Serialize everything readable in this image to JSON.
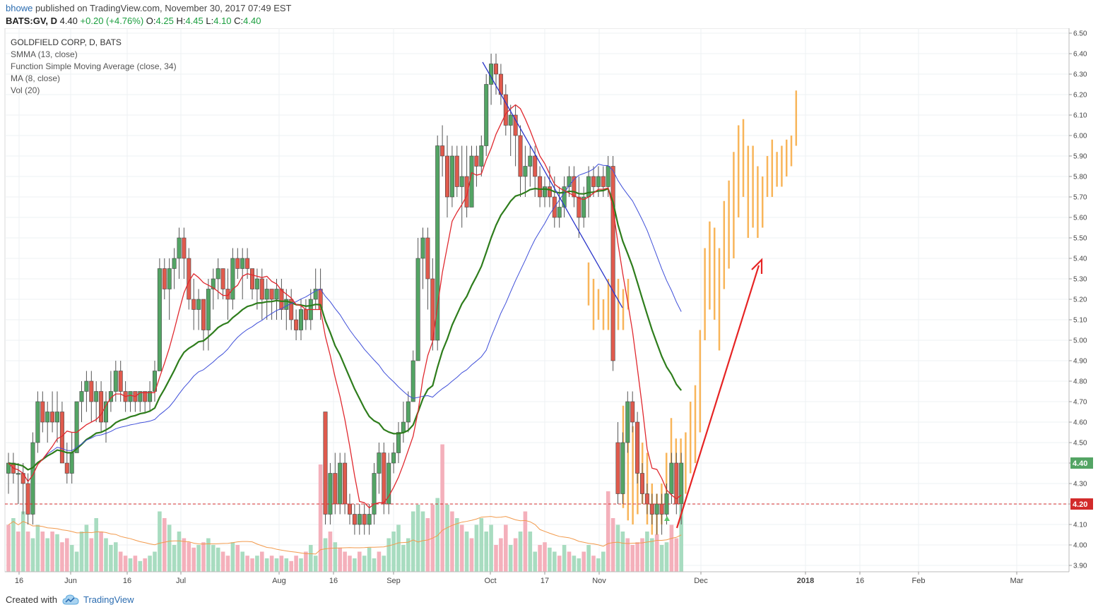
{
  "header": {
    "author": "bhowe",
    "published_text": "published on TradingView.com, November 30, 2017 07:49 EST",
    "symbol": "BATS:GV, D",
    "last": "4.40",
    "change": "+0.20 (+4.76%)",
    "o_label": "O:",
    "o_value": "4.25",
    "h_label": "H:",
    "h_value": "4.45",
    "l_label": "L:",
    "l_value": "4.10",
    "c_label": "C:",
    "c_value": "4.40"
  },
  "legend": {
    "title": "GOLDFIELD CORP, D, BATS",
    "lines": [
      "SMMA (13, close)",
      "Function Simple Moving Average (close, 34)",
      "MA (8, close)",
      "Vol (20)"
    ]
  },
  "footer": {
    "created_with": "Created with",
    "brand": "TradingView"
  },
  "colors": {
    "up": "#53a464",
    "down": "#e05a4d",
    "smma": "#2e7d1c",
    "sma34": "#3f4fd9",
    "ma8": "#e0292f",
    "vol_ma": "#f29a4c",
    "vol_up": "#a8dcc0",
    "vol_down": "#f4b0bb",
    "projection": "#f8b55a",
    "trend_blue": "#2a35c9",
    "arrow": "#e62424",
    "hline": "#d22b2b"
  },
  "chart_data": {
    "type": "candlestick",
    "symbol": "BATS:GV",
    "ylim": [
      3.85,
      6.5
    ],
    "y_ticks": [
      "6.50",
      "6.40",
      "6.30",
      "6.20",
      "6.10",
      "6.00",
      "5.90",
      "5.80",
      "5.70",
      "5.60",
      "5.50",
      "5.40",
      "5.30",
      "5.20",
      "5.10",
      "5.00",
      "4.90",
      "4.80",
      "4.70",
      "4.60",
      "4.50",
      "4.40",
      "4.30",
      "4.20",
      "4.10",
      "4.00",
      "3.90"
    ],
    "x_ticks": [
      "16",
      "Jun",
      "16",
      "Jul",
      "Aug",
      "16",
      "Sep",
      "Oct",
      "17",
      "Nov",
      "Dec",
      "2018",
      "16",
      "Feb",
      "Mar"
    ],
    "last_price_label": "4.40",
    "horizontal_line": {
      "value": 4.2,
      "label": "4.20"
    },
    "candles": [
      {
        "o": 4.35,
        "h": 4.45,
        "l": 4.25,
        "c": 4.4
      },
      {
        "o": 4.4,
        "h": 4.45,
        "l": 4.3,
        "c": 4.35
      },
      {
        "o": 4.35,
        "h": 4.4,
        "l": 4.2,
        "c": 4.35
      },
      {
        "o": 4.35,
        "h": 4.4,
        "l": 4.15,
        "c": 4.3
      },
      {
        "o": 4.3,
        "h": 4.35,
        "l": 4.1,
        "c": 4.15
      },
      {
        "o": 4.15,
        "h": 4.55,
        "l": 4.1,
        "c": 4.5
      },
      {
        "o": 4.5,
        "h": 4.75,
        "l": 4.45,
        "c": 4.7
      },
      {
        "o": 4.7,
        "h": 4.75,
        "l": 4.55,
        "c": 4.6
      },
      {
        "o": 4.6,
        "h": 4.7,
        "l": 4.5,
        "c": 4.65
      },
      {
        "o": 4.65,
        "h": 4.75,
        "l": 4.55,
        "c": 4.6
      },
      {
        "o": 4.6,
        "h": 4.75,
        "l": 4.5,
        "c": 4.65
      },
      {
        "o": 4.65,
        "h": 4.7,
        "l": 4.4,
        "c": 4.4
      },
      {
        "o": 4.4,
        "h": 4.5,
        "l": 4.3,
        "c": 4.35
      },
      {
        "o": 4.35,
        "h": 4.55,
        "l": 4.3,
        "c": 4.45
      },
      {
        "o": 4.45,
        "h": 4.7,
        "l": 4.45,
        "c": 4.7
      },
      {
        "o": 4.7,
        "h": 4.8,
        "l": 4.6,
        "c": 4.75
      },
      {
        "o": 4.75,
        "h": 4.85,
        "l": 4.65,
        "c": 4.8
      },
      {
        "o": 4.8,
        "h": 4.85,
        "l": 4.6,
        "c": 4.7
      },
      {
        "o": 4.7,
        "h": 4.8,
        "l": 4.6,
        "c": 4.75
      },
      {
        "o": 4.75,
        "h": 4.8,
        "l": 4.55,
        "c": 4.6
      },
      {
        "o": 4.6,
        "h": 4.75,
        "l": 4.5,
        "c": 4.7
      },
      {
        "o": 4.7,
        "h": 4.85,
        "l": 4.65,
        "c": 4.75
      },
      {
        "o": 4.75,
        "h": 4.9,
        "l": 4.7,
        "c": 4.85
      },
      {
        "o": 4.85,
        "h": 4.9,
        "l": 4.7,
        "c": 4.75
      },
      {
        "o": 4.75,
        "h": 4.8,
        "l": 4.65,
        "c": 4.7
      },
      {
        "o": 4.7,
        "h": 4.75,
        "l": 4.65,
        "c": 4.75
      },
      {
        "o": 4.75,
        "h": 4.75,
        "l": 4.65,
        "c": 4.7
      },
      {
        "o": 4.7,
        "h": 4.75,
        "l": 4.65,
        "c": 4.75
      },
      {
        "o": 4.75,
        "h": 4.75,
        "l": 4.65,
        "c": 4.7
      },
      {
        "o": 4.7,
        "h": 4.8,
        "l": 4.65,
        "c": 4.75
      },
      {
        "o": 4.75,
        "h": 4.9,
        "l": 4.7,
        "c": 4.85
      },
      {
        "o": 4.85,
        "h": 5.4,
        "l": 4.85,
        "c": 5.35
      },
      {
        "o": 5.35,
        "h": 5.4,
        "l": 5.2,
        "c": 5.25
      },
      {
        "o": 5.25,
        "h": 5.4,
        "l": 5.1,
        "c": 5.35
      },
      {
        "o": 5.35,
        "h": 5.45,
        "l": 5.25,
        "c": 5.4
      },
      {
        "o": 5.4,
        "h": 5.55,
        "l": 5.3,
        "c": 5.5
      },
      {
        "o": 5.5,
        "h": 5.55,
        "l": 5.3,
        "c": 5.4
      },
      {
        "o": 5.4,
        "h": 5.45,
        "l": 5.15,
        "c": 5.2
      },
      {
        "o": 5.2,
        "h": 5.3,
        "l": 5.05,
        "c": 5.15
      },
      {
        "o": 5.15,
        "h": 5.25,
        "l": 5.05,
        "c": 5.2
      },
      {
        "o": 5.2,
        "h": 5.2,
        "l": 4.95,
        "c": 5.05
      },
      {
        "o": 5.05,
        "h": 5.3,
        "l": 4.95,
        "c": 5.25
      },
      {
        "o": 5.25,
        "h": 5.35,
        "l": 5.15,
        "c": 5.3
      },
      {
        "o": 5.3,
        "h": 5.4,
        "l": 5.2,
        "c": 5.35
      },
      {
        "o": 5.35,
        "h": 5.35,
        "l": 5.2,
        "c": 5.25
      },
      {
        "o": 5.25,
        "h": 5.35,
        "l": 5.1,
        "c": 5.2
      },
      {
        "o": 5.2,
        "h": 5.45,
        "l": 5.15,
        "c": 5.4
      },
      {
        "o": 5.4,
        "h": 5.45,
        "l": 5.3,
        "c": 5.35
      },
      {
        "o": 5.35,
        "h": 5.45,
        "l": 5.2,
        "c": 5.4
      },
      {
        "o": 5.4,
        "h": 5.45,
        "l": 5.3,
        "c": 5.35
      },
      {
        "o": 5.35,
        "h": 5.35,
        "l": 5.2,
        "c": 5.25
      },
      {
        "o": 5.25,
        "h": 5.35,
        "l": 5.15,
        "c": 5.3
      },
      {
        "o": 5.3,
        "h": 5.35,
        "l": 5.1,
        "c": 5.2
      },
      {
        "o": 5.2,
        "h": 5.3,
        "l": 5.1,
        "c": 5.25
      },
      {
        "o": 5.25,
        "h": 5.25,
        "l": 5.1,
        "c": 5.2
      },
      {
        "o": 5.2,
        "h": 5.3,
        "l": 5.1,
        "c": 5.25
      },
      {
        "o": 5.25,
        "h": 5.3,
        "l": 5.1,
        "c": 5.15
      },
      {
        "o": 5.15,
        "h": 5.25,
        "l": 5.05,
        "c": 5.2
      },
      {
        "o": 5.2,
        "h": 5.25,
        "l": 5.05,
        "c": 5.1
      },
      {
        "o": 5.1,
        "h": 5.15,
        "l": 5.0,
        "c": 5.05
      },
      {
        "o": 5.05,
        "h": 5.2,
        "l": 5.0,
        "c": 5.15
      },
      {
        "o": 5.15,
        "h": 5.2,
        "l": 5.05,
        "c": 5.1
      },
      {
        "o": 5.1,
        "h": 5.25,
        "l": 5.05,
        "c": 5.2
      },
      {
        "o": 5.2,
        "h": 5.35,
        "l": 5.15,
        "c": 5.25
      },
      {
        "o": 5.25,
        "h": 5.35,
        "l": 5.1,
        "c": 5.15
      },
      {
        "o": 4.65,
        "h": 4.65,
        "l": 4.1,
        "c": 4.15
      },
      {
        "o": 4.15,
        "h": 4.4,
        "l": 4.1,
        "c": 4.35
      },
      {
        "o": 4.35,
        "h": 4.45,
        "l": 4.15,
        "c": 4.2
      },
      {
        "o": 4.2,
        "h": 4.45,
        "l": 4.15,
        "c": 4.4
      },
      {
        "o": 4.4,
        "h": 4.45,
        "l": 4.15,
        "c": 4.2
      },
      {
        "o": 4.2,
        "h": 4.25,
        "l": 4.1,
        "c": 4.15
      },
      {
        "o": 4.15,
        "h": 4.2,
        "l": 4.05,
        "c": 4.1
      },
      {
        "o": 4.1,
        "h": 4.2,
        "l": 4.05,
        "c": 4.15
      },
      {
        "o": 4.15,
        "h": 4.2,
        "l": 4.05,
        "c": 4.1
      },
      {
        "o": 4.1,
        "h": 4.2,
        "l": 4.05,
        "c": 4.15
      },
      {
        "o": 4.15,
        "h": 4.4,
        "l": 4.1,
        "c": 4.35
      },
      {
        "o": 4.35,
        "h": 4.5,
        "l": 4.25,
        "c": 4.45
      },
      {
        "o": 4.45,
        "h": 4.5,
        "l": 4.15,
        "c": 4.2
      },
      {
        "o": 4.2,
        "h": 4.45,
        "l": 4.15,
        "c": 4.4
      },
      {
        "o": 4.4,
        "h": 4.5,
        "l": 4.35,
        "c": 4.45
      },
      {
        "o": 4.45,
        "h": 4.6,
        "l": 4.4,
        "c": 4.55
      },
      {
        "o": 4.55,
        "h": 4.7,
        "l": 4.5,
        "c": 4.6
      },
      {
        "o": 4.6,
        "h": 4.75,
        "l": 4.55,
        "c": 4.7
      },
      {
        "o": 4.7,
        "h": 4.95,
        "l": 4.7,
        "c": 4.9
      },
      {
        "o": 4.9,
        "h": 5.5,
        "l": 4.9,
        "c": 5.4
      },
      {
        "o": 5.4,
        "h": 5.55,
        "l": 5.25,
        "c": 5.5
      },
      {
        "o": 5.5,
        "h": 5.55,
        "l": 5.15,
        "c": 5.3
      },
      {
        "o": 5.3,
        "h": 5.4,
        "l": 4.95,
        "c": 5.0
      },
      {
        "o": 5.0,
        "h": 6.0,
        "l": 4.95,
        "c": 5.95
      },
      {
        "o": 5.95,
        "h": 6.05,
        "l": 5.8,
        "c": 5.9
      },
      {
        "o": 5.9,
        "h": 6.0,
        "l": 5.6,
        "c": 5.7
      },
      {
        "o": 5.7,
        "h": 5.95,
        "l": 5.65,
        "c": 5.9
      },
      {
        "o": 5.9,
        "h": 5.95,
        "l": 5.7,
        "c": 5.75
      },
      {
        "o": 5.75,
        "h": 5.95,
        "l": 5.55,
        "c": 5.8
      },
      {
        "o": 5.8,
        "h": 5.95,
        "l": 5.6,
        "c": 5.65
      },
      {
        "o": 5.65,
        "h": 5.95,
        "l": 5.65,
        "c": 5.9
      },
      {
        "o": 5.9,
        "h": 5.95,
        "l": 5.75,
        "c": 5.85
      },
      {
        "o": 5.85,
        "h": 6.0,
        "l": 5.8,
        "c": 5.95
      },
      {
        "o": 5.95,
        "h": 6.3,
        "l": 5.9,
        "c": 6.25
      },
      {
        "o": 6.25,
        "h": 6.4,
        "l": 6.15,
        "c": 6.35
      },
      {
        "o": 6.35,
        "h": 6.4,
        "l": 6.2,
        "c": 6.3
      },
      {
        "o": 6.3,
        "h": 6.35,
        "l": 6.15,
        "c": 6.2
      },
      {
        "o": 6.2,
        "h": 6.25,
        "l": 6.0,
        "c": 6.05
      },
      {
        "o": 6.05,
        "h": 6.15,
        "l": 5.9,
        "c": 6.1
      },
      {
        "o": 6.1,
        "h": 6.15,
        "l": 5.85,
        "c": 6.0
      },
      {
        "o": 6.0,
        "h": 6.05,
        "l": 5.7,
        "c": 5.8
      },
      {
        "o": 5.8,
        "h": 5.95,
        "l": 5.7,
        "c": 5.85
      },
      {
        "o": 5.85,
        "h": 5.95,
        "l": 5.75,
        "c": 5.9
      },
      {
        "o": 5.9,
        "h": 5.95,
        "l": 5.7,
        "c": 5.8
      },
      {
        "o": 5.8,
        "h": 5.85,
        "l": 5.65,
        "c": 5.7
      },
      {
        "o": 5.7,
        "h": 5.8,
        "l": 5.65,
        "c": 5.75
      },
      {
        "o": 5.75,
        "h": 5.85,
        "l": 5.65,
        "c": 5.7
      },
      {
        "o": 5.7,
        "h": 5.8,
        "l": 5.55,
        "c": 5.6
      },
      {
        "o": 5.6,
        "h": 5.75,
        "l": 5.55,
        "c": 5.65
      },
      {
        "o": 5.65,
        "h": 5.8,
        "l": 5.6,
        "c": 5.75
      },
      {
        "o": 5.75,
        "h": 5.85,
        "l": 5.7,
        "c": 5.8
      },
      {
        "o": 5.8,
        "h": 5.85,
        "l": 5.65,
        "c": 5.7
      },
      {
        "o": 5.7,
        "h": 5.8,
        "l": 5.5,
        "c": 5.6
      },
      {
        "o": 5.6,
        "h": 5.75,
        "l": 5.55,
        "c": 5.7
      },
      {
        "o": 5.7,
        "h": 5.85,
        "l": 5.6,
        "c": 5.8
      },
      {
        "o": 5.8,
        "h": 5.85,
        "l": 5.7,
        "c": 5.75
      },
      {
        "o": 5.75,
        "h": 5.85,
        "l": 5.7,
        "c": 5.8
      },
      {
        "o": 5.8,
        "h": 5.85,
        "l": 5.7,
        "c": 5.75
      },
      {
        "o": 5.75,
        "h": 5.9,
        "l": 5.7,
        "c": 5.85
      },
      {
        "o": 5.85,
        "h": 5.9,
        "l": 4.85,
        "c": 4.9
      },
      {
        "o": 4.5,
        "h": 4.6,
        "l": 4.2,
        "c": 4.25
      },
      {
        "o": 4.25,
        "h": 4.55,
        "l": 4.2,
        "c": 4.5
      },
      {
        "o": 4.5,
        "h": 4.75,
        "l": 4.45,
        "c": 4.7
      },
      {
        "o": 4.7,
        "h": 4.75,
        "l": 4.55,
        "c": 4.6
      },
      {
        "o": 4.6,
        "h": 4.65,
        "l": 4.3,
        "c": 4.35
      },
      {
        "o": 4.35,
        "h": 4.4,
        "l": 4.2,
        "c": 4.25
      },
      {
        "o": 4.25,
        "h": 4.3,
        "l": 4.15,
        "c": 4.2
      },
      {
        "o": 4.2,
        "h": 4.25,
        "l": 4.1,
        "c": 4.15
      },
      {
        "o": 4.15,
        "h": 4.25,
        "l": 4.05,
        "c": 4.2
      },
      {
        "o": 4.2,
        "h": 4.25,
        "l": 4.05,
        "c": 4.15
      },
      {
        "o": 4.15,
        "h": 4.3,
        "l": 4.1,
        "c": 4.25
      },
      {
        "o": 4.25,
        "h": 4.45,
        "l": 4.2,
        "c": 4.4
      },
      {
        "o": 4.4,
        "h": 4.45,
        "l": 4.15,
        "c": 4.2
      },
      {
        "o": 4.2,
        "h": 4.45,
        "l": 4.1,
        "c": 4.4
      }
    ],
    "volume": {
      "ylim": [
        0,
        1
      ],
      "values": [
        0.35,
        0.4,
        0.3,
        0.45,
        0.3,
        0.25,
        0.35,
        0.3,
        0.25,
        0.3,
        0.28,
        0.22,
        0.25,
        0.2,
        0.15,
        0.3,
        0.35,
        0.25,
        0.4,
        0.3,
        0.25,
        0.2,
        0.22,
        0.15,
        0.12,
        0.1,
        0.12,
        0.08,
        0.1,
        0.12,
        0.15,
        0.45,
        0.4,
        0.35,
        0.2,
        0.3,
        0.25,
        0.22,
        0.18,
        0.2,
        0.22,
        0.25,
        0.2,
        0.18,
        0.15,
        0.12,
        0.22,
        0.2,
        0.15,
        0.12,
        0.1,
        0.12,
        0.15,
        0.1,
        0.12,
        0.1,
        0.12,
        0.1,
        0.08,
        0.12,
        0.1,
        0.15,
        0.2,
        0.12,
        0.8,
        0.25,
        0.3,
        0.22,
        0.18,
        0.15,
        0.12,
        0.1,
        0.15,
        0.12,
        0.18,
        0.1,
        0.15,
        0.12,
        0.25,
        0.3,
        0.35,
        0.2,
        0.25,
        0.45,
        0.5,
        0.45,
        0.4,
        0.5,
        0.55,
        0.95,
        0.5,
        0.45,
        0.4,
        0.35,
        0.3,
        0.25,
        0.35,
        0.4,
        0.3,
        0.35,
        0.2,
        0.25,
        0.35,
        0.2,
        0.25,
        0.3,
        0.45,
        0.3,
        0.15,
        0.2,
        0.22,
        0.18,
        0.15,
        0.12,
        0.2,
        0.15,
        0.12,
        0.1,
        0.15,
        0.2,
        0.12,
        0.1,
        0.15,
        0.6,
        0.4,
        0.35,
        0.3,
        0.25,
        0.2,
        0.22,
        0.25,
        0.3,
        0.25,
        0.28,
        0.2,
        0.22,
        0.35,
        0.25,
        0.5
      ],
      "directions": [
        "d",
        "u",
        "d",
        "u",
        "d",
        "u",
        "u",
        "d",
        "u",
        "d",
        "u",
        "d",
        "d",
        "u",
        "u",
        "u",
        "u",
        "d",
        "u",
        "d",
        "u",
        "u",
        "u",
        "d",
        "d",
        "u",
        "d",
        "u",
        "d",
        "u",
        "u",
        "u",
        "d",
        "u",
        "u",
        "u",
        "d",
        "d",
        "d",
        "u",
        "d",
        "u",
        "u",
        "u",
        "d",
        "d",
        "u",
        "d",
        "u",
        "d",
        "d",
        "u",
        "d",
        "u",
        "d",
        "u",
        "d",
        "u",
        "d",
        "d",
        "u",
        "d",
        "u",
        "u",
        "d",
        "u",
        "d",
        "u",
        "d",
        "d",
        "d",
        "u",
        "d",
        "u",
        "u",
        "u",
        "d",
        "u",
        "u",
        "u",
        "u",
        "u",
        "u",
        "u",
        "u",
        "u",
        "d",
        "d",
        "u",
        "d",
        "u",
        "d",
        "u",
        "d",
        "u",
        "d",
        "u",
        "u",
        "u",
        "u",
        "d",
        "d",
        "d",
        "u",
        "d",
        "u",
        "d",
        "u",
        "u",
        "d",
        "d",
        "u",
        "u",
        "d",
        "u",
        "d",
        "u",
        "u",
        "d",
        "u",
        "d",
        "u",
        "u",
        "d",
        "d",
        "u",
        "u",
        "d",
        "d",
        "d",
        "d",
        "u",
        "u",
        "d",
        "u",
        "u",
        "d",
        "d",
        "u"
      ]
    },
    "series": [
      {
        "name": "SMMA (13, close)"
      },
      {
        "name": "Function Simple Moving Average (close, 34)"
      },
      {
        "name": "MA (8, close)"
      },
      {
        "name": "Vol (20)"
      }
    ]
  }
}
